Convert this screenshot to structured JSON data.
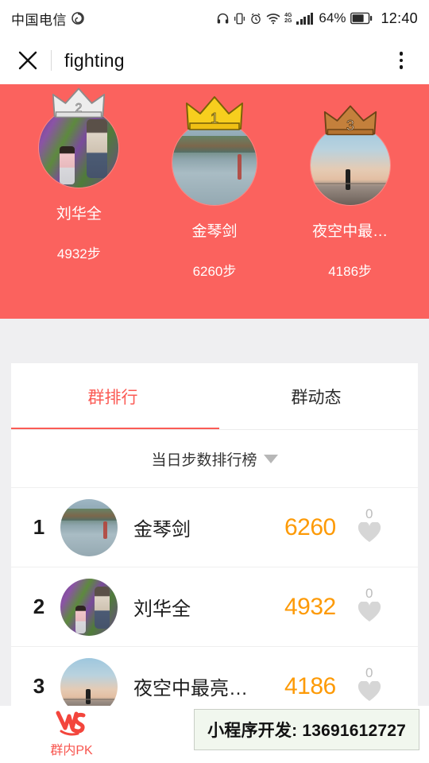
{
  "status_bar": {
    "carrier": "中国电信",
    "music_icon": "music-note-icon",
    "headphone_icon": "headphone-icon",
    "vibrate_icon": "vibrate-icon",
    "alarm_icon": "alarm-clock-icon",
    "wifi_icon": "wifi-icon",
    "network_top": "4G",
    "network_bottom": "2G",
    "battery_percent": "64%",
    "time": "12:40"
  },
  "nav": {
    "close_icon": "close-icon",
    "title": "fighting",
    "more_icon": "more-vertical-icon"
  },
  "podium": {
    "background_color": "#FB625E",
    "entries": [
      {
        "rank": "2",
        "crown": "silver-crown-icon",
        "crown_color": "#E8E8E8",
        "name": "刘华全",
        "steps": "4932步",
        "photo": "family-flowers-photo"
      },
      {
        "rank": "1",
        "crown": "gold-crown-icon",
        "crown_color": "#F7CE1E",
        "name": "金琴剑",
        "steps": "6260步",
        "photo": "lake-temple-photo"
      },
      {
        "rank": "3",
        "crown": "bronze-crown-icon",
        "crown_color": "#C4803C",
        "name": "夜空中最…",
        "steps": "4186步",
        "photo": "beach-sunset-photo"
      }
    ]
  },
  "tabs": {
    "active_color": "#FB5B55",
    "items": [
      {
        "label": "群排行",
        "active": true
      },
      {
        "label": "群动态",
        "active": false
      }
    ]
  },
  "filter": {
    "label": "当日步数排行榜",
    "caret_icon": "caret-down-icon"
  },
  "ranking": {
    "steps_color": "#FD9A06",
    "rows": [
      {
        "rank": "1",
        "name": "金琴剑",
        "steps": "6260",
        "likes": "0",
        "heart_icon": "heart-icon",
        "photo": "lake-temple-photo"
      },
      {
        "rank": "2",
        "name": "刘华全",
        "steps": "4932",
        "likes": "0",
        "heart_icon": "heart-icon",
        "photo": "family-flowers-photo"
      },
      {
        "rank": "3",
        "name": "夜空中最亮…",
        "steps": "4186",
        "likes": "0",
        "heart_icon": "heart-icon",
        "photo": "beach-sunset-photo"
      }
    ]
  },
  "bottom_bar": {
    "pk_icon": "vs-versus-icon",
    "pk_label": "群内PK"
  },
  "overlay_note": {
    "label": "小程序开发:",
    "phone": "13691612727",
    "background_color": "#F1F7EE"
  }
}
